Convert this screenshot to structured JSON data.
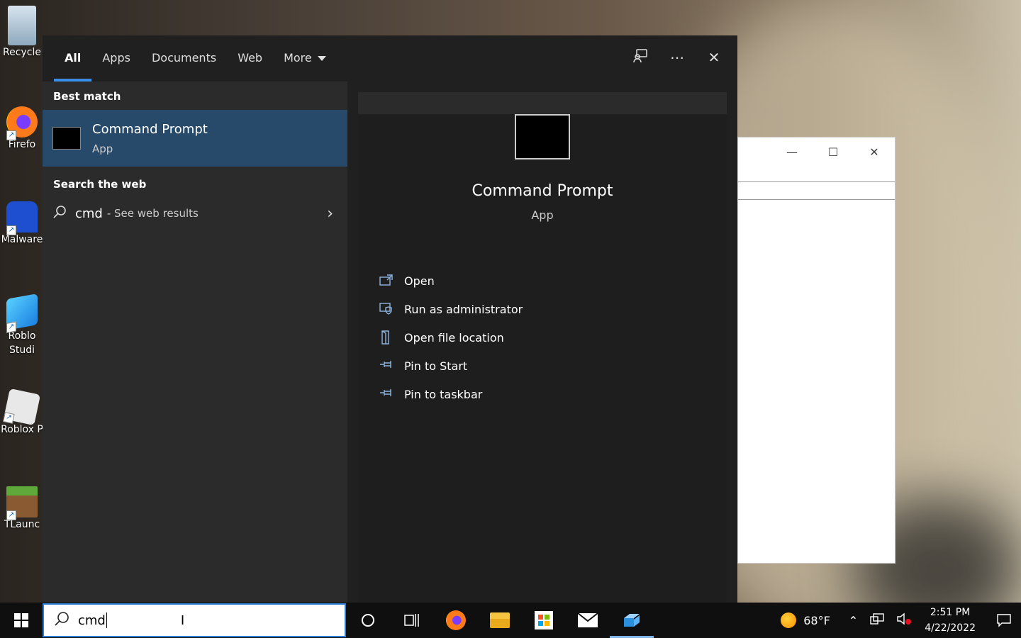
{
  "desktop": {
    "icons": [
      {
        "label": "Recycle"
      },
      {
        "label": "Firefo"
      },
      {
        "label": "Malware"
      },
      {
        "label": "Roblo Studi"
      },
      {
        "label": "Roblox P"
      },
      {
        "label": "TLaunc"
      }
    ]
  },
  "search_panel": {
    "tabs": [
      {
        "label": "All"
      },
      {
        "label": "Apps"
      },
      {
        "label": "Documents"
      },
      {
        "label": "Web"
      },
      {
        "label": "More"
      }
    ],
    "best_match": {
      "section_title": "Best match",
      "name": "Command Prompt",
      "type": "App"
    },
    "web": {
      "section_title": "Search the web",
      "query": "cmd",
      "suffix": "- See web results"
    },
    "detail": {
      "name": "Command Prompt",
      "type": "App",
      "actions": [
        {
          "label": "Open",
          "icon": "open-icon"
        },
        {
          "label": "Run as administrator",
          "icon": "shield-icon"
        },
        {
          "label": "Open file location",
          "icon": "folder-icon"
        },
        {
          "label": "Pin to Start",
          "icon": "pin-icon"
        },
        {
          "label": "Pin to taskbar",
          "icon": "pin-icon"
        }
      ]
    }
  },
  "taskbar": {
    "search_value": "cmd",
    "weather": "68°F",
    "time": "2:51 PM",
    "date": "4/22/2022"
  }
}
